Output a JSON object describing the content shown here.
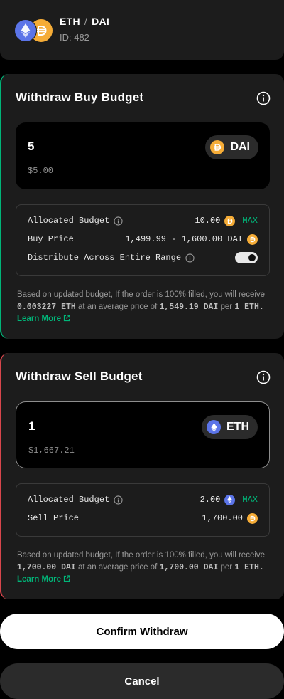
{
  "pair": {
    "base": "ETH",
    "separator": "/",
    "quote": "DAI",
    "id_label": "ID: 482"
  },
  "buy": {
    "title": "Withdraw Buy Budget",
    "amount": "5",
    "amount_usd": "$5.00",
    "token": "DAI",
    "allocated_label": "Allocated Budget",
    "allocated_value": "10.00",
    "max_label": "MAX",
    "price_label": "Buy Price",
    "price_value": "1,499.99 - 1,600.00 DAI",
    "distribute_label": "Distribute Across Entire Range",
    "distribute_on": true,
    "note_prefix": "Based on updated budget, If the order is 100% filled, you will receive",
    "note_amount": "0.003227 ETH",
    "note_mid": "at an average price of",
    "note_price": "1,549.19 DAI",
    "note_suffix": "per",
    "note_unit": "1 ETH.",
    "learn_more": "Learn More"
  },
  "sell": {
    "title": "Withdraw Sell Budget",
    "amount": "1",
    "amount_usd": "$1,667.21",
    "token": "ETH",
    "allocated_label": "Allocated Budget",
    "allocated_value": "2.00",
    "max_label": "MAX",
    "price_label": "Sell Price",
    "price_value": "1,700.00",
    "note_prefix": "Based on updated budget, If the order is 100% filled, you will receive",
    "note_amount": "1,700.00 DAI",
    "note_mid": "at an average price of",
    "note_price": "1,700.00 DAI",
    "note_suffix": "per",
    "note_unit": "1 ETH.",
    "learn_more": "Learn More"
  },
  "actions": {
    "confirm": "Confirm Withdraw",
    "cancel": "Cancel"
  },
  "colors": {
    "buy_accent": "#00b578",
    "sell_accent": "#d8464c",
    "eth": "#5b74e8",
    "dai": "#f5ac37"
  }
}
